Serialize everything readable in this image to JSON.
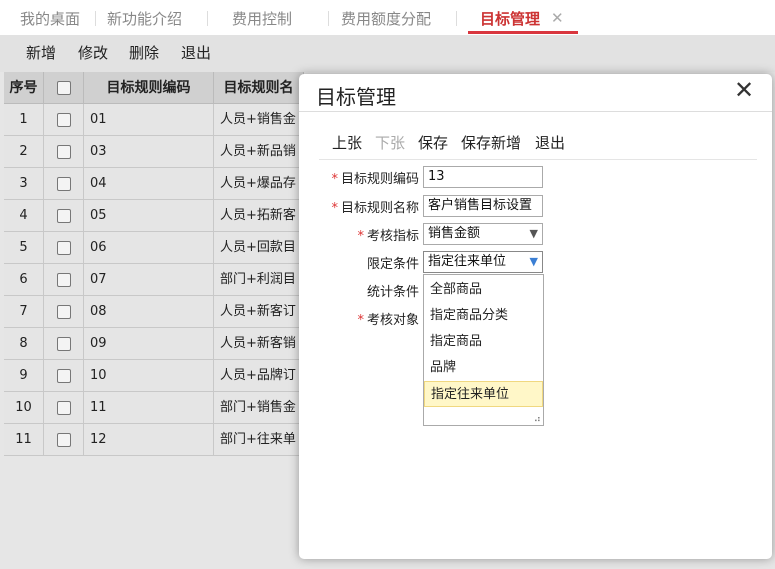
{
  "tabs": [
    {
      "label": "我的桌面"
    },
    {
      "label": "新功能介绍"
    },
    {
      "label": "费用控制"
    },
    {
      "label": "费用额度分配"
    },
    {
      "label": "目标管理"
    }
  ],
  "tab_close": "✕",
  "toolbar": {
    "add": "新增",
    "edit": "修改",
    "delete": "删除",
    "exit": "退出"
  },
  "grid": {
    "headers": {
      "seq": "序号",
      "code": "目标规则编码",
      "name": "目标规则名"
    },
    "rows": [
      {
        "seq": "1",
        "code": "01",
        "name": "人员+销售金"
      },
      {
        "seq": "2",
        "code": "03",
        "name": "人员+新品销"
      },
      {
        "seq": "3",
        "code": "04",
        "name": "人员+爆品存"
      },
      {
        "seq": "4",
        "code": "05",
        "name": "人员+拓新客"
      },
      {
        "seq": "5",
        "code": "06",
        "name": "人员+回款目"
      },
      {
        "seq": "6",
        "code": "07",
        "name": "部门+利润目"
      },
      {
        "seq": "7",
        "code": "08",
        "name": "人员+新客订"
      },
      {
        "seq": "8",
        "code": "09",
        "name": "人员+新客销"
      },
      {
        "seq": "9",
        "code": "10",
        "name": "人员+品牌订"
      },
      {
        "seq": "10",
        "code": "11",
        "name": "部门+销售金"
      },
      {
        "seq": "11",
        "code": "12",
        "name": "部门+往来单"
      }
    ]
  },
  "modal": {
    "title": "目标管理",
    "close": "✕",
    "toolbar": {
      "prev": "上张",
      "next": "下张",
      "save": "保存",
      "save_new": "保存新增",
      "exit": "退出"
    },
    "fields": {
      "code_label": "目标规则编码",
      "code_value": "13",
      "name_label": "目标规则名称",
      "name_value": "客户销售目标设置",
      "metric_label": "考核指标",
      "metric_value": "销售金额",
      "limit_label": "限定条件",
      "limit_value": "指定往来单位",
      "stat_label": "统计条件",
      "target_label": "考核对象"
    },
    "dropdown_options": [
      "全部商品",
      "指定商品分类",
      "指定商品",
      "品牌",
      "指定往来单位"
    ],
    "required_mark": "*"
  },
  "colors": {
    "accent": "#d9363e",
    "dropdown_selected": "#fff7c8"
  }
}
